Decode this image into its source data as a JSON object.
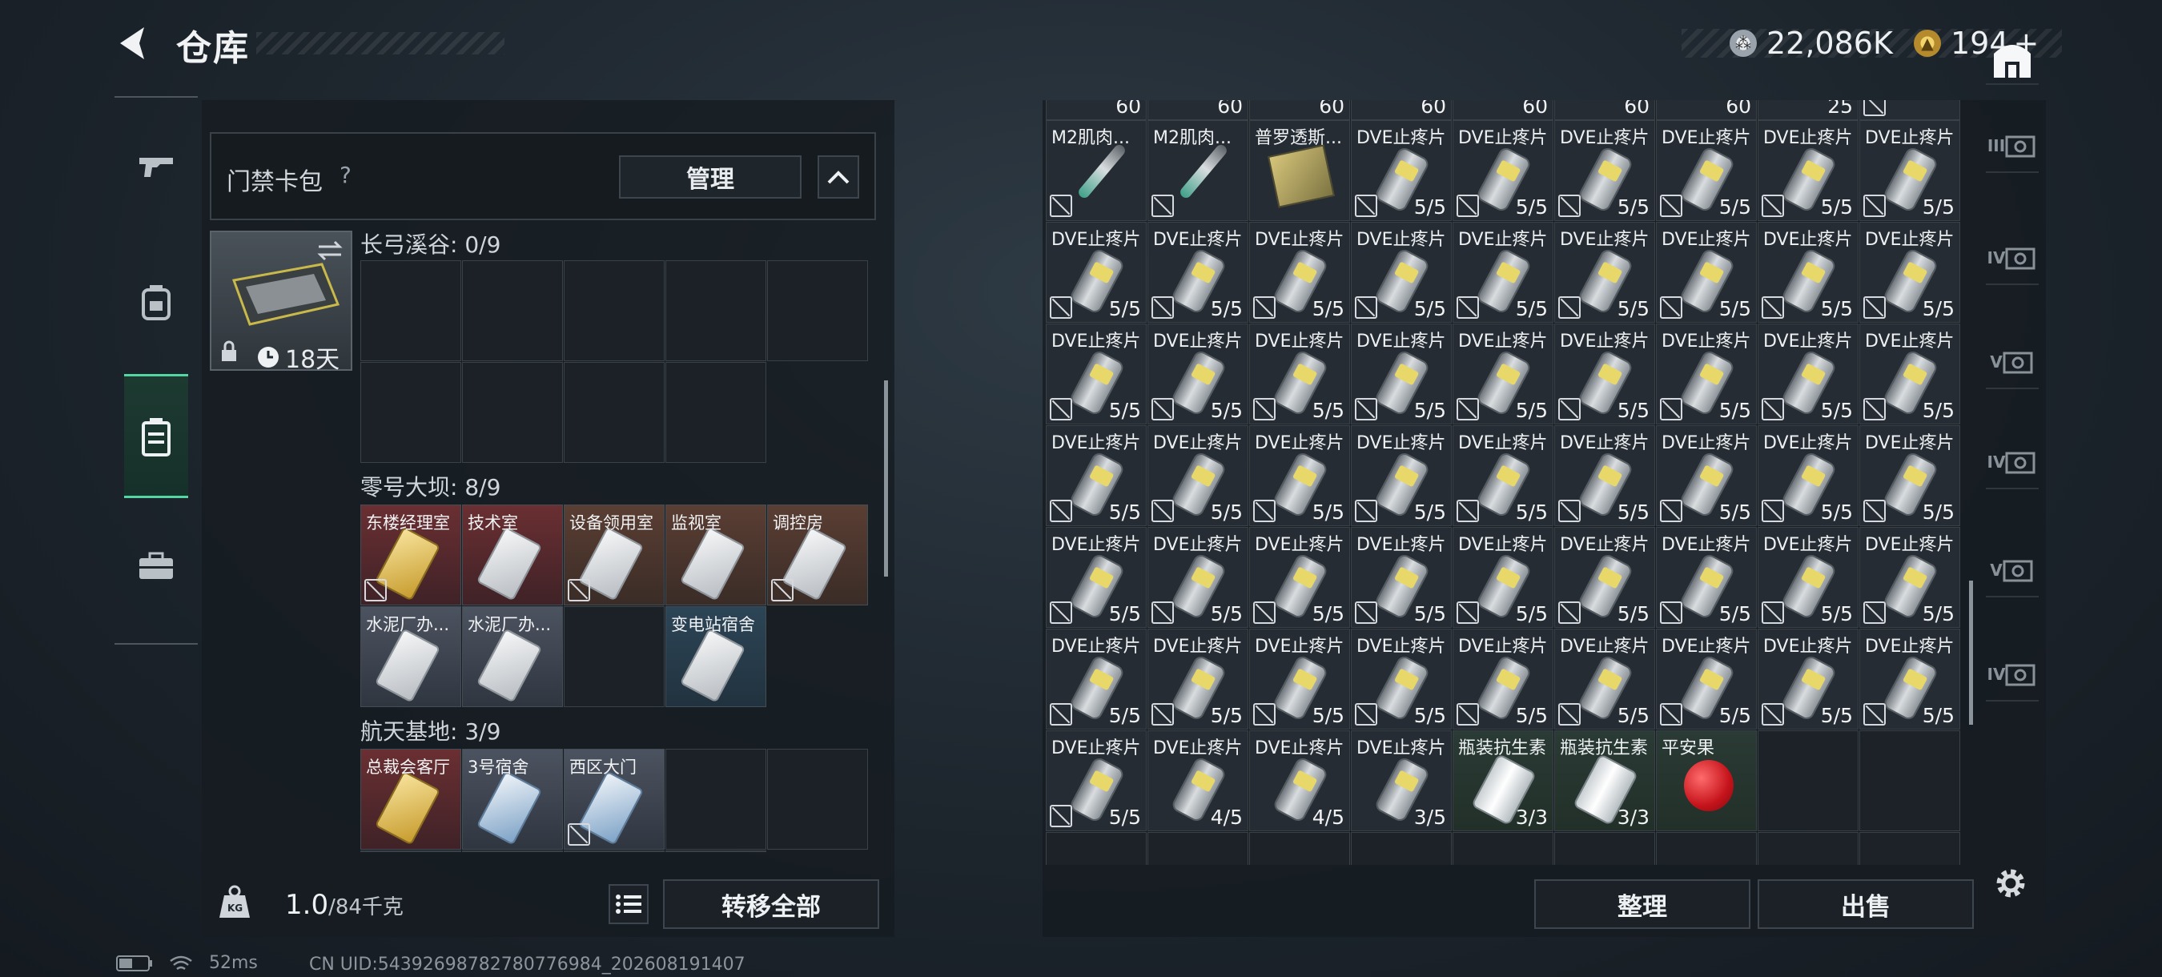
{
  "header": {
    "title": "仓库"
  },
  "currency": {
    "silver": "22,086K",
    "gold": "194",
    "gold_add": "+"
  },
  "keycard_bag": {
    "title": "门禁卡包",
    "help": "?",
    "manage_label": "管理",
    "expiry": "18天"
  },
  "sections": [
    {
      "title": "长弓溪谷: 0/9",
      "cards": []
    },
    {
      "title": "零号大坝: 8/9",
      "cards": [
        {
          "label": "东楼经理室",
          "color": "red",
          "style": "gold",
          "nodisc": true
        },
        {
          "label": "技术室",
          "color": "red",
          "style": "white",
          "nodisc": false
        },
        {
          "label": "设备领用室",
          "color": "brown",
          "style": "white",
          "nodisc": true
        },
        {
          "label": "监视室",
          "color": "brown",
          "style": "white",
          "nodisc": false
        },
        {
          "label": "调控房",
          "color": "brown",
          "style": "white",
          "nodisc": true
        },
        {
          "label": "水泥厂办...",
          "color": "gray",
          "style": "white",
          "nodisc": false
        },
        {
          "label": "水泥厂办...",
          "color": "gray",
          "style": "white",
          "nodisc": false
        },
        {
          "label": "变电站宿舍",
          "color": "blue",
          "style": "white",
          "nodisc": false
        }
      ]
    },
    {
      "title": "航天基地: 3/9",
      "cards": [
        {
          "label": "总裁会客厅",
          "color": "red",
          "style": "gold",
          "nodisc": false
        },
        {
          "label": "3号宿舍",
          "color": "gray",
          "style": "bluec",
          "nodisc": false
        },
        {
          "label": "西区大门",
          "color": "gray",
          "style": "bluec",
          "nodisc": true
        }
      ]
    }
  ],
  "bottom_bar": {
    "weight": "1.0",
    "capacity": "/84千克",
    "transfer_label": "转移全部"
  },
  "status": {
    "ping": "52ms",
    "uid": "CN UID:5439269878278077698​4_202608191407"
  },
  "inventory": {
    "top_partial": [
      "60",
      "60",
      "60",
      "60",
      "60",
      "60",
      "60",
      "25",
      ""
    ],
    "rows": [
      [
        {
          "n": "M2肌肉...",
          "c": "",
          "t": "syringe",
          "x": 1
        },
        {
          "n": "M2肌肉...",
          "c": "",
          "t": "syringe",
          "x": 1
        },
        {
          "n": "普罗透斯...",
          "c": "",
          "t": "box",
          "x": 0
        },
        {
          "n": "DVE止疼片",
          "c": "5/5",
          "t": "pill",
          "x": 1
        },
        {
          "n": "DVE止疼片",
          "c": "5/5",
          "t": "pill",
          "x": 1
        },
        {
          "n": "DVE止疼片",
          "c": "5/5",
          "t": "pill",
          "x": 1
        },
        {
          "n": "DVE止疼片",
          "c": "5/5",
          "t": "pill",
          "x": 1
        },
        {
          "n": "DVE止疼片",
          "c": "5/5",
          "t": "pill",
          "x": 1
        },
        {
          "n": "DVE止疼片",
          "c": "5/5",
          "t": "pill",
          "x": 1
        }
      ],
      [
        {
          "n": "DVE止疼片",
          "c": "5/5",
          "t": "pill",
          "x": 1
        },
        {
          "n": "DVE止疼片",
          "c": "5/5",
          "t": "pill",
          "x": 1
        },
        {
          "n": "DVE止疼片",
          "c": "5/5",
          "t": "pill",
          "x": 1
        },
        {
          "n": "DVE止疼片",
          "c": "5/5",
          "t": "pill",
          "x": 1
        },
        {
          "n": "DVE止疼片",
          "c": "5/5",
          "t": "pill",
          "x": 1
        },
        {
          "n": "DVE止疼片",
          "c": "5/5",
          "t": "pill",
          "x": 1
        },
        {
          "n": "DVE止疼片",
          "c": "5/5",
          "t": "pill",
          "x": 1
        },
        {
          "n": "DVE止疼片",
          "c": "5/5",
          "t": "pill",
          "x": 1
        },
        {
          "n": "DVE止疼片",
          "c": "5/5",
          "t": "pill",
          "x": 1
        }
      ],
      [
        {
          "n": "DVE止疼片",
          "c": "5/5",
          "t": "pill",
          "x": 1
        },
        {
          "n": "DVE止疼片",
          "c": "5/5",
          "t": "pill",
          "x": 1
        },
        {
          "n": "DVE止疼片",
          "c": "5/5",
          "t": "pill",
          "x": 1
        },
        {
          "n": "DVE止疼片",
          "c": "5/5",
          "t": "pill",
          "x": 1
        },
        {
          "n": "DVE止疼片",
          "c": "5/5",
          "t": "pill",
          "x": 1
        },
        {
          "n": "DVE止疼片",
          "c": "5/5",
          "t": "pill",
          "x": 1
        },
        {
          "n": "DVE止疼片",
          "c": "5/5",
          "t": "pill",
          "x": 1
        },
        {
          "n": "DVE止疼片",
          "c": "5/5",
          "t": "pill",
          "x": 1
        },
        {
          "n": "DVE止疼片",
          "c": "5/5",
          "t": "pill",
          "x": 1
        }
      ],
      [
        {
          "n": "DVE止疼片",
          "c": "5/5",
          "t": "pill",
          "x": 1
        },
        {
          "n": "DVE止疼片",
          "c": "5/5",
          "t": "pill",
          "x": 1
        },
        {
          "n": "DVE止疼片",
          "c": "5/5",
          "t": "pill",
          "x": 1
        },
        {
          "n": "DVE止疼片",
          "c": "5/5",
          "t": "pill",
          "x": 1
        },
        {
          "n": "DVE止疼片",
          "c": "5/5",
          "t": "pill",
          "x": 1
        },
        {
          "n": "DVE止疼片",
          "c": "5/5",
          "t": "pill",
          "x": 1
        },
        {
          "n": "DVE止疼片",
          "c": "5/5",
          "t": "pill",
          "x": 1
        },
        {
          "n": "DVE止疼片",
          "c": "5/5",
          "t": "pill",
          "x": 1
        },
        {
          "n": "DVE止疼片",
          "c": "5/5",
          "t": "pill",
          "x": 1
        }
      ],
      [
        {
          "n": "DVE止疼片",
          "c": "5/5",
          "t": "pill",
          "x": 1
        },
        {
          "n": "DVE止疼片",
          "c": "5/5",
          "t": "pill",
          "x": 1
        },
        {
          "n": "DVE止疼片",
          "c": "5/5",
          "t": "pill",
          "x": 1
        },
        {
          "n": "DVE止疼片",
          "c": "5/5",
          "t": "pill",
          "x": 1
        },
        {
          "n": "DVE止疼片",
          "c": "5/5",
          "t": "pill",
          "x": 1
        },
        {
          "n": "DVE止疼片",
          "c": "5/5",
          "t": "pill",
          "x": 1
        },
        {
          "n": "DVE止疼片",
          "c": "5/5",
          "t": "pill",
          "x": 1
        },
        {
          "n": "DVE止疼片",
          "c": "5/5",
          "t": "pill",
          "x": 1
        },
        {
          "n": "DVE止疼片",
          "c": "5/5",
          "t": "pill",
          "x": 1
        }
      ],
      [
        {
          "n": "DVE止疼片",
          "c": "5/5",
          "t": "pill",
          "x": 1
        },
        {
          "n": "DVE止疼片",
          "c": "5/5",
          "t": "pill",
          "x": 1
        },
        {
          "n": "DVE止疼片",
          "c": "5/5",
          "t": "pill",
          "x": 1
        },
        {
          "n": "DVE止疼片",
          "c": "5/5",
          "t": "pill",
          "x": 1
        },
        {
          "n": "DVE止疼片",
          "c": "5/5",
          "t": "pill",
          "x": 1
        },
        {
          "n": "DVE止疼片",
          "c": "5/5",
          "t": "pill",
          "x": 1
        },
        {
          "n": "DVE止疼片",
          "c": "5/5",
          "t": "pill",
          "x": 1
        },
        {
          "n": "DVE止疼片",
          "c": "5/5",
          "t": "pill",
          "x": 1
        },
        {
          "n": "DVE止疼片",
          "c": "5/5",
          "t": "pill",
          "x": 1
        }
      ],
      [
        {
          "n": "DVE止疼片",
          "c": "5/5",
          "t": "pill",
          "x": 1
        },
        {
          "n": "DVE止疼片",
          "c": "4/5",
          "t": "pill",
          "x": 0
        },
        {
          "n": "DVE止疼片",
          "c": "4/5",
          "t": "pill",
          "x": 0
        },
        {
          "n": "DVE止疼片",
          "c": "3/5",
          "t": "pill",
          "x": 0
        },
        {
          "n": "瓶装抗生素",
          "c": "3/3",
          "t": "bottle",
          "x": 0,
          "g": 1
        },
        {
          "n": "瓶装抗生素",
          "c": "3/3",
          "t": "bottle",
          "x": 0,
          "g": 1
        },
        {
          "n": "平安果",
          "c": "",
          "t": "apple",
          "x": 0,
          "g": 1
        },
        {
          "n": "",
          "c": "",
          "t": "",
          "x": 0
        },
        {
          "n": "",
          "c": "",
          "t": "",
          "x": 0
        }
      ]
    ],
    "sort_label": "整理",
    "sell_label": "出售"
  },
  "right_tabs": [
    "",
    "III",
    "IV",
    "V",
    "IV",
    "V",
    "IV"
  ]
}
